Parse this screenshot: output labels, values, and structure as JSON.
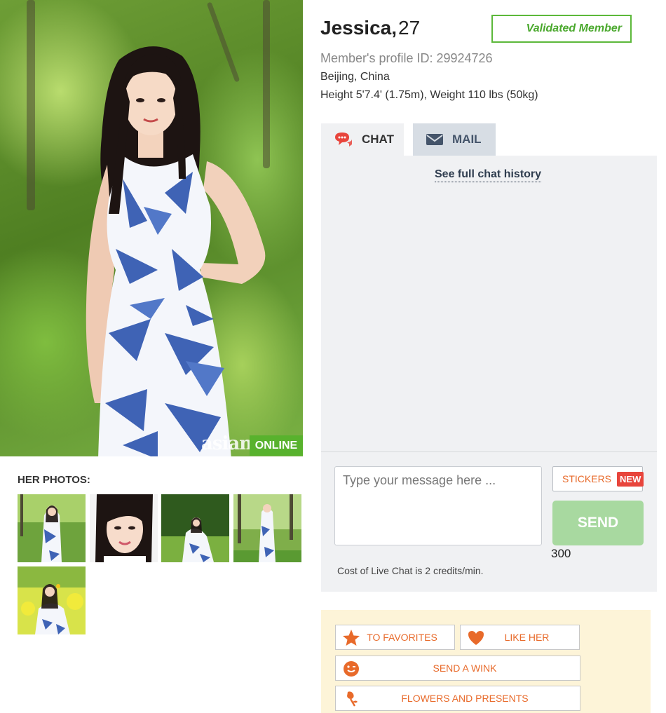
{
  "profile": {
    "name": "Jessica,",
    "age": "27",
    "validated": "Validated Member",
    "profile_id": "Member's profile ID: 29924726",
    "location": "Beijing, China",
    "height_weight": "Height 5'7.4' (1.75m), Weight 110 lbs (50kg)"
  },
  "main_photo": {
    "watermark": "asian",
    "online_badge": "ONLINE"
  },
  "photos": {
    "title": "HER PHOTOS:",
    "count": 5
  },
  "tabs": [
    {
      "label": "CHAT",
      "icon": "chat-bubble-icon",
      "active": true
    },
    {
      "label": "MAIL",
      "icon": "envelope-icon",
      "active": false
    }
  ],
  "chat": {
    "history_link": "See full chat history",
    "input_placeholder": "Type your message here ...",
    "stickers_label": "STICKERS",
    "new_badge": "NEW",
    "send_label": "SEND",
    "char_count": "300",
    "cost_text": "Cost of Live Chat is 2 credits/min."
  },
  "actions": {
    "favorites": "TO FAVORITES",
    "like": "LIKE HER",
    "wink": "SEND A WINK",
    "flowers": "FLOWERS AND PRESENTS"
  },
  "colors": {
    "accent_orange": "#e86a2a",
    "online_green": "#58b22d",
    "validated_green": "#4aa82d",
    "send_green": "#a8d9a0",
    "new_red": "#e8453c"
  }
}
